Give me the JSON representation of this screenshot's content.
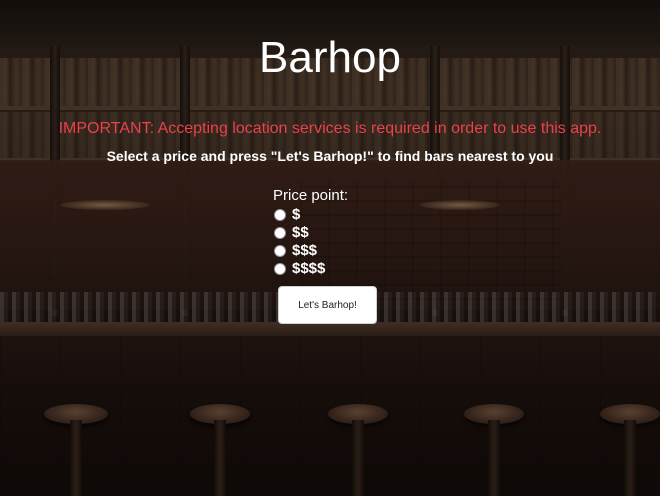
{
  "app": {
    "title": "Barhop"
  },
  "notice": {
    "warning": "IMPORTANT: Accepting location services is required in order to use this app.",
    "instructions": "Select a price and press \"Let's Barhop!\" to find bars nearest to you"
  },
  "price_form": {
    "label": "Price point:",
    "options": [
      {
        "label": "$",
        "selected": false
      },
      {
        "label": "$$",
        "selected": false
      },
      {
        "label": "$$$",
        "selected": false
      },
      {
        "label": "$$$$",
        "selected": false
      }
    ],
    "submit_label": "Let's Barhop!"
  },
  "colors": {
    "warning": "#e8424a",
    "text": "#ffffff",
    "button_bg": "#ffffff"
  }
}
